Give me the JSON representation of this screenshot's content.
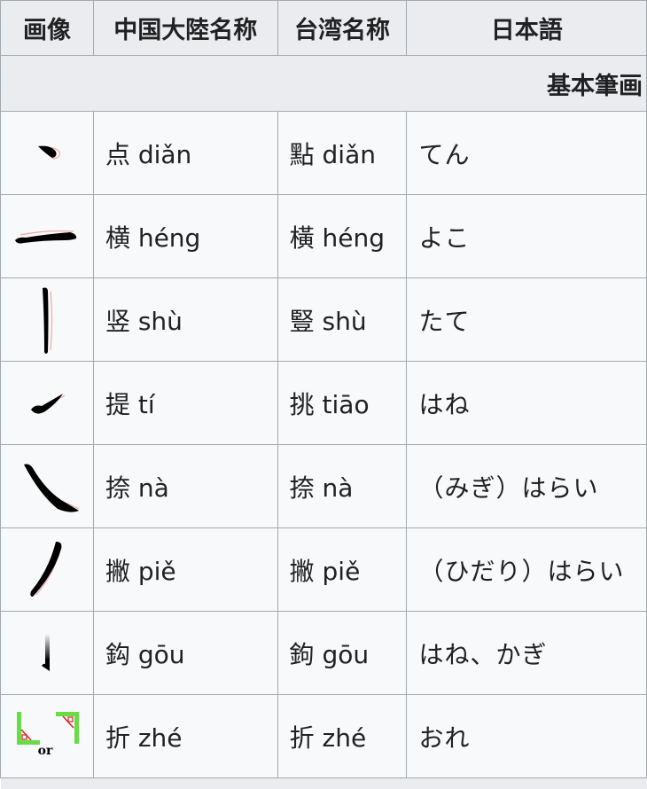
{
  "headers": {
    "image": "画像",
    "mainland_name": "中国大陸名称",
    "taiwan_name": "台湾名称",
    "japanese": "日本語"
  },
  "section_title": "基本筆画",
  "rows": [
    {
      "stroke_icon": "dian-stroke-icon",
      "mainland": "点 diǎn",
      "taiwan": "點 diǎn",
      "japanese": "てん"
    },
    {
      "stroke_icon": "heng-stroke-icon",
      "mainland": "横 héng",
      "taiwan": "橫 héng",
      "japanese": "よこ"
    },
    {
      "stroke_icon": "shu-stroke-icon",
      "mainland": "竖 shù",
      "taiwan": "豎 shù",
      "japanese": "たて"
    },
    {
      "stroke_icon": "ti-stroke-icon",
      "mainland": "提 tí",
      "taiwan": "挑 tiāo",
      "japanese": "はね"
    },
    {
      "stroke_icon": "na-stroke-icon",
      "mainland": "捺 nà",
      "taiwan": "捺 nà",
      "japanese": "（みぎ）はらい"
    },
    {
      "stroke_icon": "pie-stroke-icon",
      "mainland": "撇 piě",
      "taiwan": "撇 piě",
      "japanese": "（ひだり）はらい"
    },
    {
      "stroke_icon": "gou-stroke-icon",
      "mainland": "鈎 gōu",
      "taiwan": "鉤 gōu",
      "japanese": "はね、かぎ"
    },
    {
      "stroke_icon": "zhe-stroke-icon",
      "mainland": "折 zhé",
      "taiwan": "折 zhé",
      "japanese": "おれ",
      "icon_caption": "or"
    }
  ],
  "colors": {
    "header_bg": "#eaecf0",
    "cell_bg": "#f8f9fa",
    "border": "#a2a9b1",
    "stroke": "#000000",
    "stroke_guide": "#f4a6a6",
    "zhe_green": "#66dd44",
    "zhe_red": "#dd2222"
  }
}
